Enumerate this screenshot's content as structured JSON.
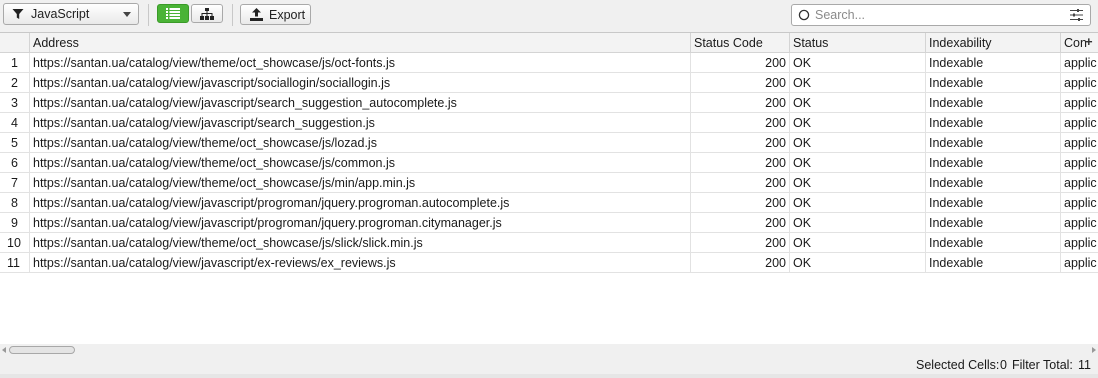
{
  "toolbar": {
    "filter": {
      "selected": "JavaScript",
      "icon": "filter-icon"
    },
    "view_list_icon": "list-view-icon",
    "view_tree_icon": "tree-view-icon",
    "export_label": "Export",
    "export_icon": "export-icon",
    "search_placeholder": "Search...",
    "accent_color": "#4ab336"
  },
  "table": {
    "columns": [
      "",
      "Address",
      "Status Code",
      "Status",
      "Indexability",
      "Con"
    ],
    "add_column_symbol": "+",
    "rows": [
      {
        "n": "1",
        "address": "https://santan.ua/catalog/view/theme/oct_showcase/js/oct-fonts.js",
        "code": "200",
        "status": "OK",
        "index": "Indexable",
        "content": "applic"
      },
      {
        "n": "2",
        "address": "https://santan.ua/catalog/view/javascript/sociallogin/sociallogin.js",
        "code": "200",
        "status": "OK",
        "index": "Indexable",
        "content": "applic"
      },
      {
        "n": "3",
        "address": "https://santan.ua/catalog/view/javascript/search_suggestion_autocomplete.js",
        "code": "200",
        "status": "OK",
        "index": "Indexable",
        "content": "applic"
      },
      {
        "n": "4",
        "address": "https://santan.ua/catalog/view/javascript/search_suggestion.js",
        "code": "200",
        "status": "OK",
        "index": "Indexable",
        "content": "applic"
      },
      {
        "n": "5",
        "address": "https://santan.ua/catalog/view/theme/oct_showcase/js/lozad.js",
        "code": "200",
        "status": "OK",
        "index": "Indexable",
        "content": "applic"
      },
      {
        "n": "6",
        "address": "https://santan.ua/catalog/view/theme/oct_showcase/js/common.js",
        "code": "200",
        "status": "OK",
        "index": "Indexable",
        "content": "applic"
      },
      {
        "n": "7",
        "address": "https://santan.ua/catalog/view/theme/oct_showcase/js/min/app.min.js",
        "code": "200",
        "status": "OK",
        "index": "Indexable",
        "content": "applic"
      },
      {
        "n": "8",
        "address": "https://santan.ua/catalog/view/javascript/progroman/jquery.progroman.autocomplete.js",
        "code": "200",
        "status": "OK",
        "index": "Indexable",
        "content": "applic"
      },
      {
        "n": "9",
        "address": "https://santan.ua/catalog/view/javascript/progroman/jquery.progroman.citymanager.js",
        "code": "200",
        "status": "OK",
        "index": "Indexable",
        "content": "applic"
      },
      {
        "n": "10",
        "address": "https://santan.ua/catalog/view/theme/oct_showcase/js/slick/slick.min.js",
        "code": "200",
        "status": "OK",
        "index": "Indexable",
        "content": "applic"
      },
      {
        "n": "11",
        "address": "https://santan.ua/catalog/view/javascript/ex-reviews/ex_reviews.js",
        "code": "200",
        "status": "OK",
        "index": "Indexable",
        "content": "applic"
      }
    ]
  },
  "status_bar": {
    "selected_cells_label": "Selected Cells:",
    "selected_cells_value": "0",
    "filter_total_label": "Filter Total:",
    "filter_total_value": "11"
  }
}
